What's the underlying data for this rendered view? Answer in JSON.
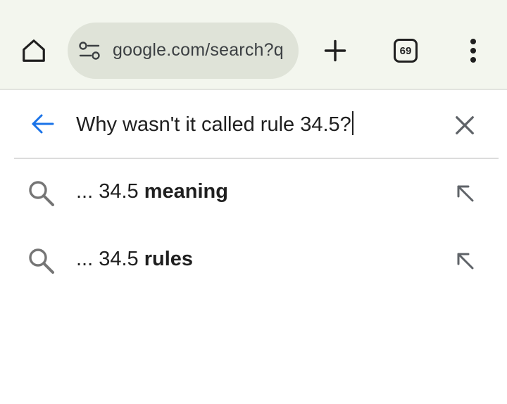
{
  "toolbar": {
    "url": "google.com/search?q",
    "tab_count": "69"
  },
  "search": {
    "query": "Why wasn't it called rule 34.5?"
  },
  "suggestions": [
    {
      "prefix": "... 34.5 ",
      "bold": "meaning"
    },
    {
      "prefix": "... 34.5 ",
      "bold": "rules"
    }
  ],
  "icons": {
    "home": "home-icon",
    "site_settings": "tune-icon",
    "new_tab": "plus-icon",
    "tab_switcher": "tab-count-icon",
    "menu": "more-vert-icon",
    "back": "arrow-back-icon",
    "clear": "close-icon",
    "suggestion_search": "search-icon",
    "suggestion_fill": "arrow-up-left-icon"
  },
  "colors": {
    "toolbar_bg": "#f3f6ee",
    "omnibox_bg": "#dfe3d8",
    "accent": "#1a73e8",
    "icon_gray": "#5f6368"
  }
}
